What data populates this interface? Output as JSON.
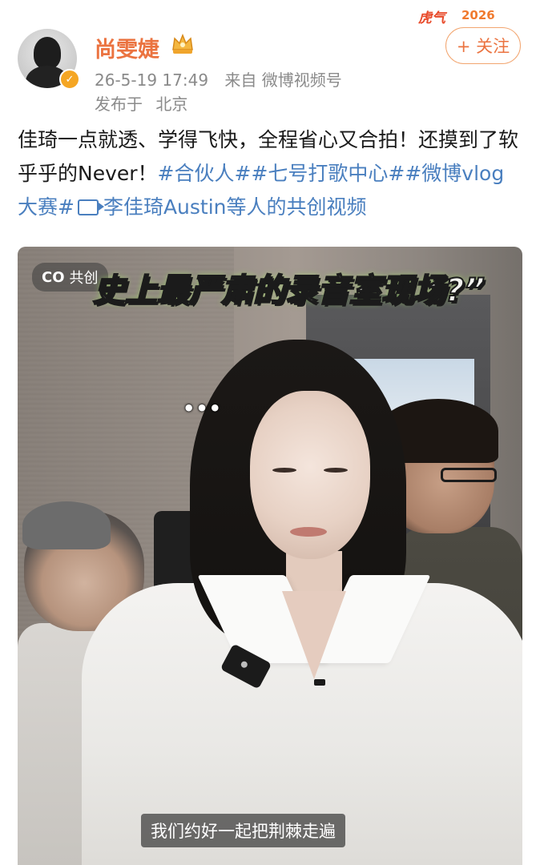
{
  "user": {
    "name": "尚雯婕",
    "verified_icon": "verified-badge-icon",
    "vip_icon": "crown-vip-icon"
  },
  "post_meta": {
    "date": "26-5-19 17:49",
    "source": "来自 微博视频号",
    "location_label": "发布于",
    "location": "北京"
  },
  "header_decoration": {
    "text_a": "虎气",
    "text_b": "2026"
  },
  "follow_button": {
    "label": "+ 关注"
  },
  "post_text": {
    "body": "佳琦一点就透、学得飞快，全程省心又合拍！还摸到了软乎乎的Never！",
    "tag1": "#合伙人#",
    "tag2": "#七号打歌中心#",
    "tag3": "#微博vlog大赛#",
    "cocreate_text": "李佳琦Austin等人的共创视频"
  },
  "video": {
    "collab_badge": "共创",
    "collab_icon": "CO",
    "title_caption": "史上最严肃的录音室现场?”",
    "subtitle": "我们约好一起把荆棘走遍",
    "dots": "•••"
  },
  "colors": {
    "username": "#eb7340",
    "tag": "#4a7fbf",
    "meta": "#8a8a8a",
    "follow_border": "#f2a56f"
  }
}
